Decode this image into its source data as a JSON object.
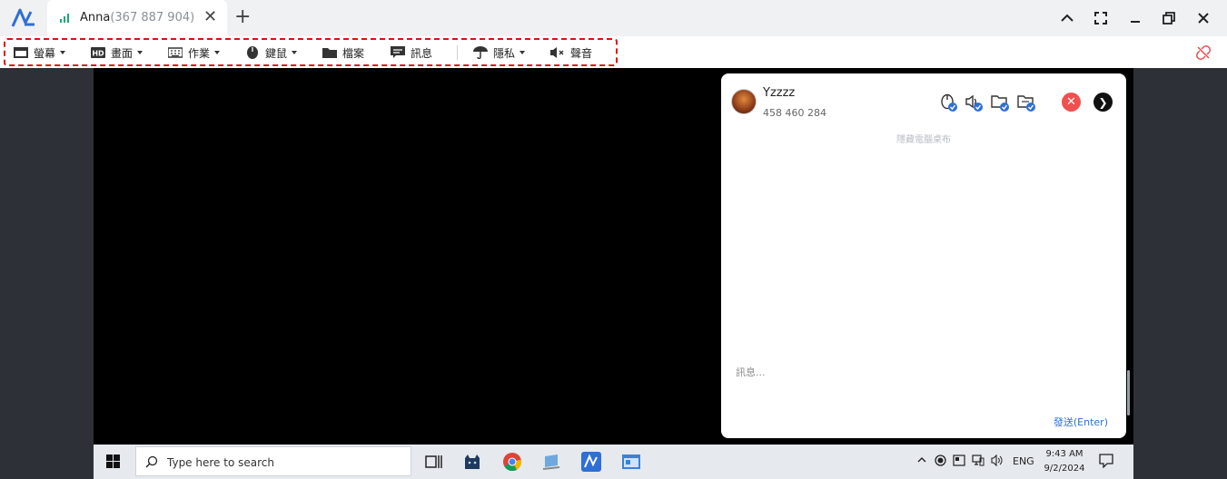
{
  "app": {
    "tab_name": "Anna",
    "tab_id": "(367 887 904)",
    "new_tab": "+"
  },
  "toolbar": {
    "items": [
      {
        "label": "螢幕",
        "icon": "monitor-icon"
      },
      {
        "label": "畫面",
        "icon": "hd-icon"
      },
      {
        "label": "作業",
        "icon": "keyboard-icon"
      },
      {
        "label": "鍵鼠",
        "icon": "mouse-icon"
      },
      {
        "label": "檔案",
        "icon": "folder-icon"
      },
      {
        "label": "訊息",
        "icon": "chat-icon"
      },
      {
        "label": "隱私",
        "icon": "umbrella-icon"
      },
      {
        "label": "聲音",
        "icon": "mute-icon"
      }
    ]
  },
  "panel": {
    "name": "Yzzzz",
    "id": "458 460 284",
    "hint": "隱藏電腦桌布",
    "message_placeholder": "訊息...",
    "send_label": "發送(Enter)"
  },
  "taskbar": {
    "search_placeholder": "Type here to search",
    "lang": "ENG",
    "time": "9:43 AM",
    "date": "9/2/2024"
  },
  "colors": {
    "accent": "#2f6fd6",
    "highlight_box": "#e01010",
    "remote_bg": "#000000",
    "viewer_bg": "#2d3036"
  }
}
